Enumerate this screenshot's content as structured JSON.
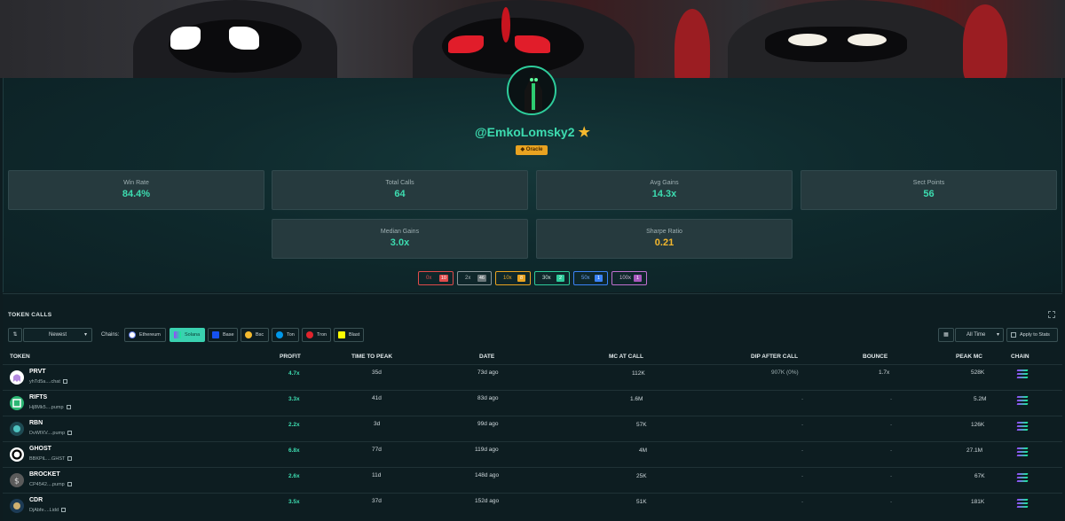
{
  "profile": {
    "username": "@EmkoLomsky2",
    "badge": "Oracle"
  },
  "stats": [
    {
      "label": "Win Rate",
      "value": "84.4%",
      "color": "#3ddcb0"
    },
    {
      "label": "Total Calls",
      "value": "64",
      "color": "#3ddcb0"
    },
    {
      "label": "Avg Gains",
      "value": "14.3x",
      "color": "#3ddcb0"
    },
    {
      "label": "Sect Points",
      "value": "56",
      "color": "#3ddcb0"
    },
    {
      "label": "Median Gains",
      "value": "3.0x",
      "color": "#3ddcb0"
    },
    {
      "label": "Sharpe Ratio",
      "value": "0.21",
      "color": "#f5b82e"
    }
  ],
  "multipliers": [
    {
      "label": "0x",
      "count": "10",
      "color": "#e04b4b"
    },
    {
      "label": "2x",
      "count": "46",
      "color": "#8a9699"
    },
    {
      "label": "10x",
      "count": "8",
      "color": "#e9a321"
    },
    {
      "label": "30x",
      "count": "2",
      "color": "#2ecc9b"
    },
    {
      "label": "50x",
      "count": "1",
      "color": "#3b82f6"
    },
    {
      "label": "100x",
      "count": "1",
      "color": "#c070d0"
    }
  ],
  "token_calls": {
    "title": "TOKEN CALLS",
    "sort_value": "Newest",
    "chains_label": "Chains:",
    "chains": [
      "Ethereum",
      "Solana",
      "Base",
      "Bsc",
      "Ton",
      "Tron",
      "Blast"
    ],
    "active_chain": "Solana",
    "time_filter": "All Time",
    "apply_label": "Apply to Stats",
    "columns": [
      "TOKEN",
      "PROFIT",
      "TIME TO PEAK",
      "DATE",
      "MC AT CALL",
      "DIP AFTER CALL",
      "BOUNCE",
      "PEAK MC",
      "CHAIN"
    ],
    "rows": [
      {
        "name": "PRVT",
        "addr": "yhTd5a....chat",
        "profit": "4.7x",
        "ttp": "35d",
        "date": "73d ago",
        "mc": "112K",
        "dip": "907K (0%)",
        "bounce": "1.7x",
        "peak": "528K"
      },
      {
        "name": "RIFTS",
        "addr": "Hj8Mk5....pump",
        "profit": "3.3x",
        "ttp": "41d",
        "date": "83d ago",
        "mc": "1.6M",
        "dip": "-",
        "bounce": "-",
        "peak": "5.2M"
      },
      {
        "name": "RBN",
        "addr": "DvWfXV....pump",
        "profit": "2.2x",
        "ttp": "3d",
        "date": "99d ago",
        "mc": "57K",
        "dip": "-",
        "bounce": "-",
        "peak": "126K"
      },
      {
        "name": "GHOST",
        "addr": "BBKPiL....GHST",
        "profit": "6.8x",
        "ttp": "77d",
        "date": "119d ago",
        "mc": "4M",
        "dip": "-",
        "bounce": "-",
        "peak": "27.1M"
      },
      {
        "name": "BROCKET",
        "addr": "CP4542....pump",
        "profit": "2.6x",
        "ttp": "11d",
        "date": "148d ago",
        "mc": "25K",
        "dip": "-",
        "bounce": "-",
        "peak": "67K"
      },
      {
        "name": "CDR",
        "addr": "DjAbfe....Lidd",
        "profit": "3.5x",
        "ttp": "37d",
        "date": "152d ago",
        "mc": "51K",
        "dip": "-",
        "bounce": "-",
        "peak": "181K"
      }
    ]
  }
}
